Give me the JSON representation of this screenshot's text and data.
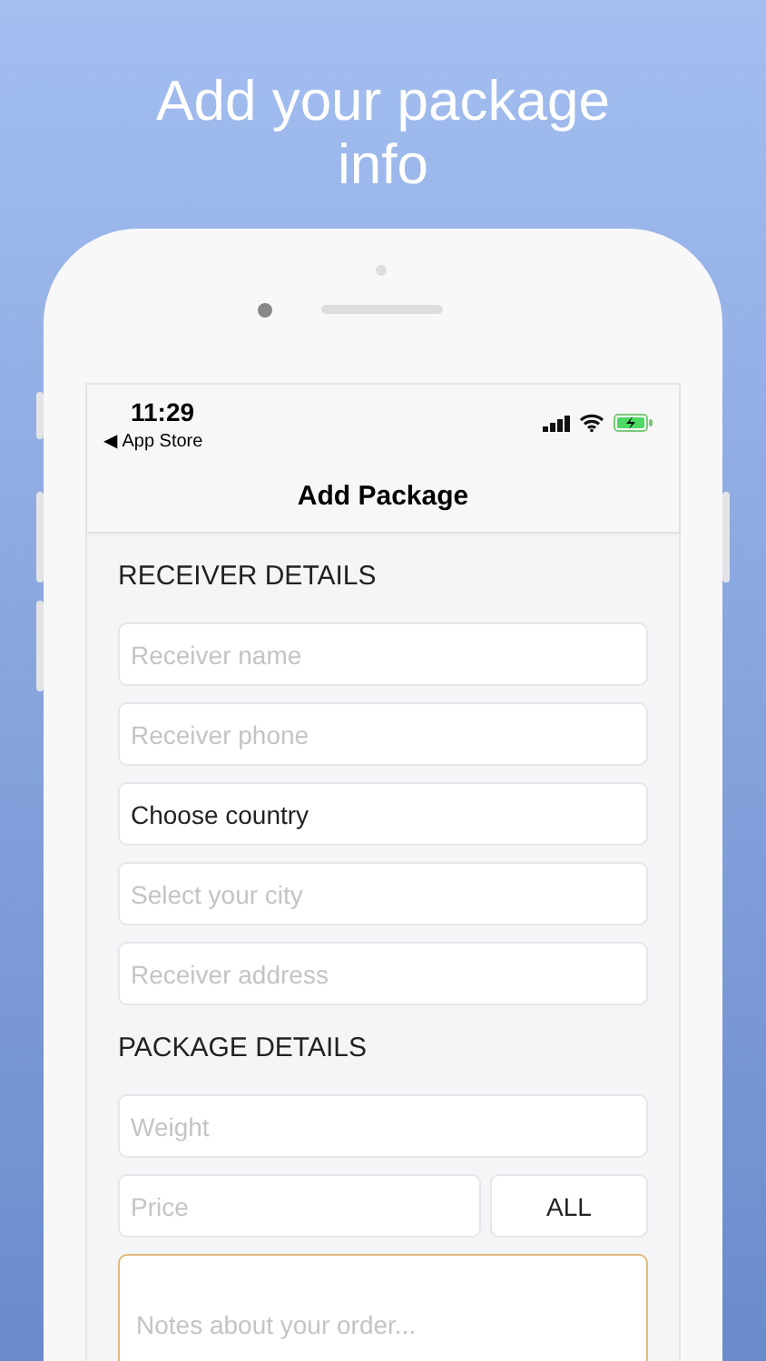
{
  "headline": "Add your package info",
  "status_bar": {
    "time": "11:29",
    "back_link": "◀ App Store"
  },
  "nav": {
    "title": "Add Package"
  },
  "sections": [
    {
      "title": "RECEIVER DETAILS",
      "fields": [
        {
          "kind": "input",
          "placeholder": "Receiver name"
        },
        {
          "kind": "input",
          "placeholder": "Receiver phone"
        },
        {
          "kind": "select",
          "value": "Choose country"
        },
        {
          "kind": "input",
          "placeholder": "Select your city"
        },
        {
          "kind": "input",
          "placeholder": "Receiver address"
        }
      ]
    },
    {
      "title": "PACKAGE DETAILS",
      "fields": [
        {
          "kind": "input",
          "placeholder": "Weight"
        },
        {
          "kind": "price",
          "placeholder": "Price",
          "currency": "ALL"
        },
        {
          "kind": "notes",
          "placeholder": "Notes about your order...",
          "focused": true
        }
      ]
    }
  ]
}
